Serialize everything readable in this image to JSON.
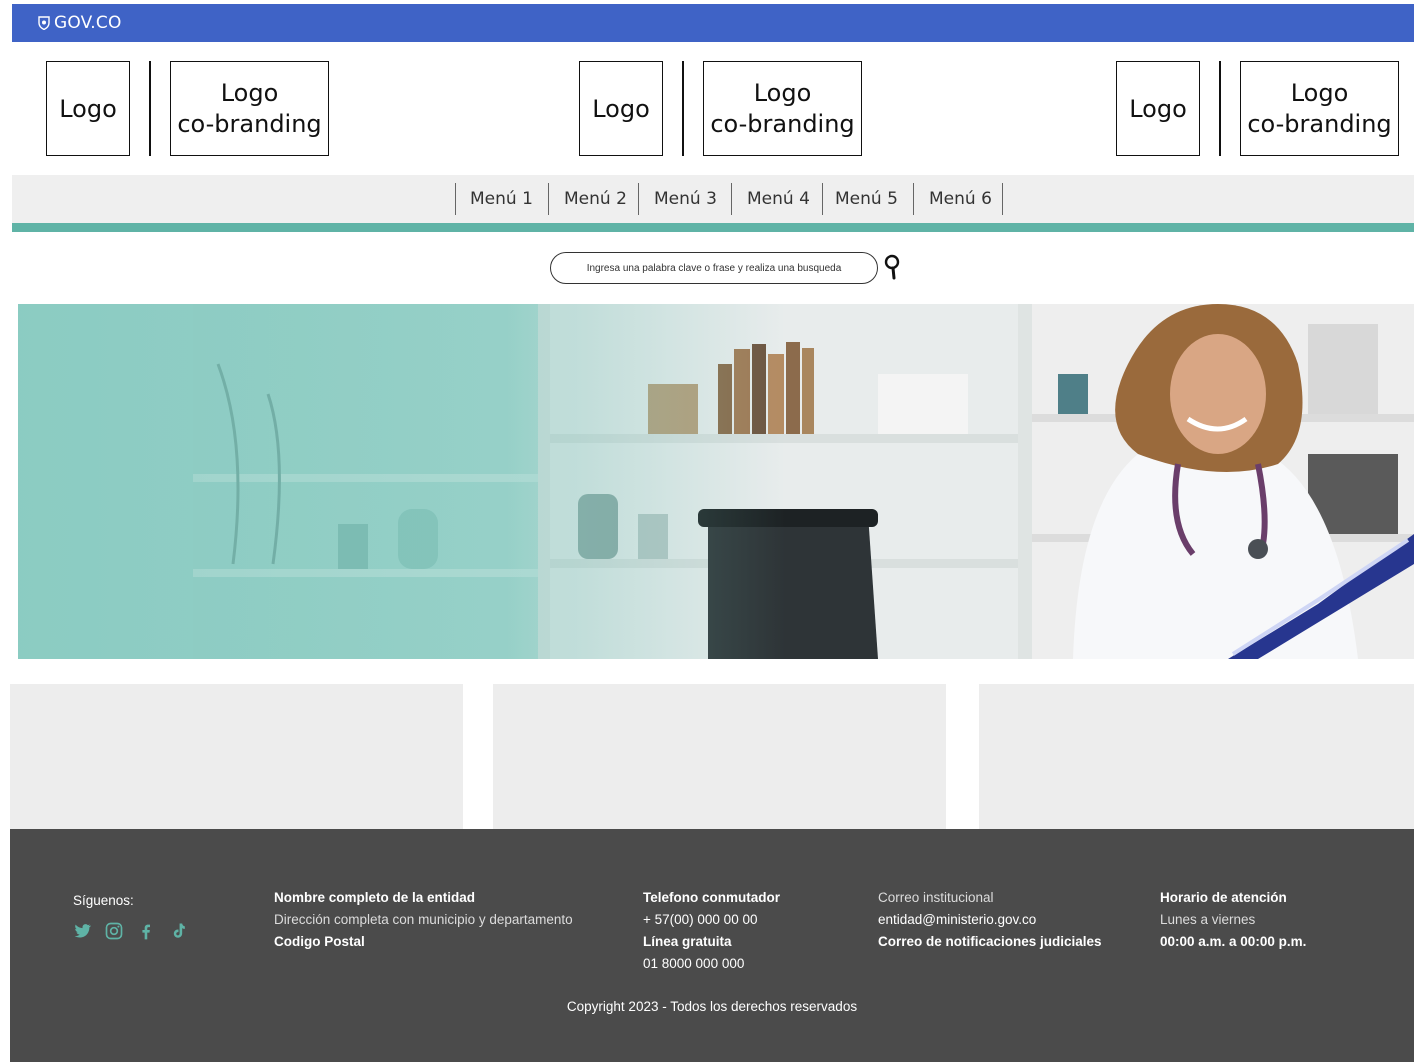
{
  "govbar": {
    "brand": "GOV.CO",
    "color": "#3f63c6"
  },
  "logos": {
    "logo_label": "Logo",
    "cobranding_line1": "Logo",
    "cobranding_line2": "co-branding"
  },
  "menu": {
    "items": [
      "Menú 1",
      "Menú 2",
      "Menú 3",
      "Menú 4",
      "Menú 5",
      "Menú 6"
    ],
    "accent_color": "#5fb3a6"
  },
  "search": {
    "placeholder": "Ingresa una palabra clave o frase y realiza una busqueda",
    "icon": "search-icon"
  },
  "hero": {
    "description": "hero-image-doctor"
  },
  "footer": {
    "follow_label": "Síguenos:",
    "social_icons": [
      "twitter-icon",
      "instagram-icon",
      "facebook-icon",
      "tiktok-icon"
    ],
    "entity": {
      "name": "Nombre completo de la entidad",
      "address": "Dirección completa con municipio y departamento",
      "postal": "Codigo Postal"
    },
    "phone": {
      "title": "Telefono conmutador",
      "number": "+ 57(00) 000 00 00",
      "free_title": "Línea gratuita",
      "free_number": "01 8000 000 000"
    },
    "email": {
      "title": "Correo institucional",
      "address": "entidad@ministerio.gov.co",
      "judicial": "Correo de notificaciones judiciales"
    },
    "hours": {
      "title": "Horario de atención",
      "days": "Lunes a viernes",
      "time": "00:00 a.m. a 00:00 p.m."
    },
    "copyright": "Copyright 2023 - Todos los derechos reservados",
    "background": "#4b4b4b",
    "icon_color": "#5fb3a6"
  }
}
